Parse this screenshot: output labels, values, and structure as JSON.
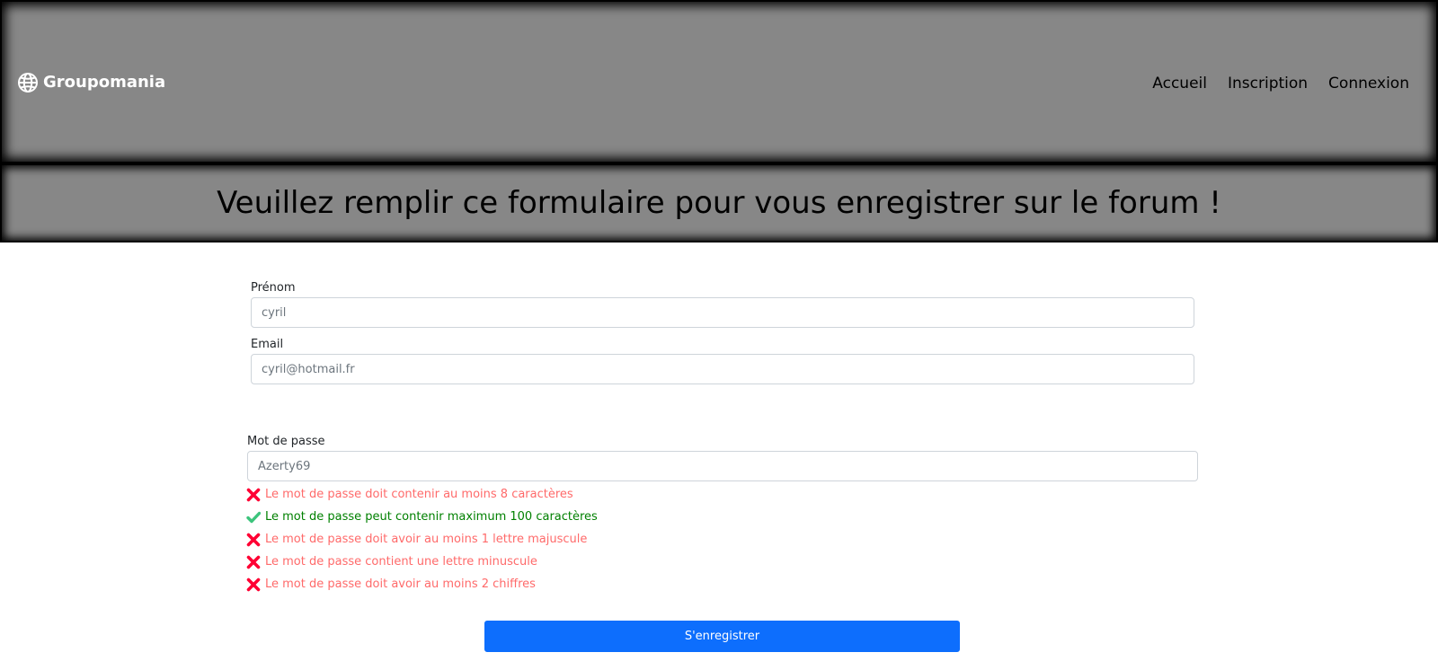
{
  "navbar": {
    "brand": "Groupomania",
    "brand_icon": "globe-icon",
    "links": [
      "Accueil",
      "Inscription",
      "Connexion"
    ]
  },
  "banner": {
    "title": "Veuillez remplir ce formulaire pour vous enregistrer sur le forum !"
  },
  "form": {
    "first_name": {
      "label": "Prénom",
      "placeholder": "cyril"
    },
    "email": {
      "label": "Email",
      "placeholder": "cyril@hotmail.fr"
    },
    "password": {
      "label": "Mot de passe",
      "placeholder": "Azerty69"
    },
    "password_rules": [
      {
        "text": "Le mot de passe doit contenir au moins 8 caractères",
        "status": "fail",
        "icon": "cross-icon"
      },
      {
        "text": "Le mot de passe peut contenir maximum 100 caractères",
        "status": "ok",
        "icon": "check-icon"
      },
      {
        "text": "Le mot de passe doit avoir au moins 1 lettre majuscule",
        "status": "fail",
        "icon": "cross-icon"
      },
      {
        "text": "Le mot de passe contient une lettre minuscule",
        "status": "fail",
        "icon": "cross-icon"
      },
      {
        "text": "Le mot de passe doit avoir au moins 2 chiffres",
        "status": "fail",
        "icon": "cross-icon"
      }
    ],
    "submit_label": "S'enregistrer"
  },
  "colors": {
    "header_bg": "#878787",
    "primary": "#0d6efd",
    "error": "#ff6a6a",
    "error_icon": "#ff0033",
    "success": "#008000",
    "success_icon": "#3cc47c"
  }
}
